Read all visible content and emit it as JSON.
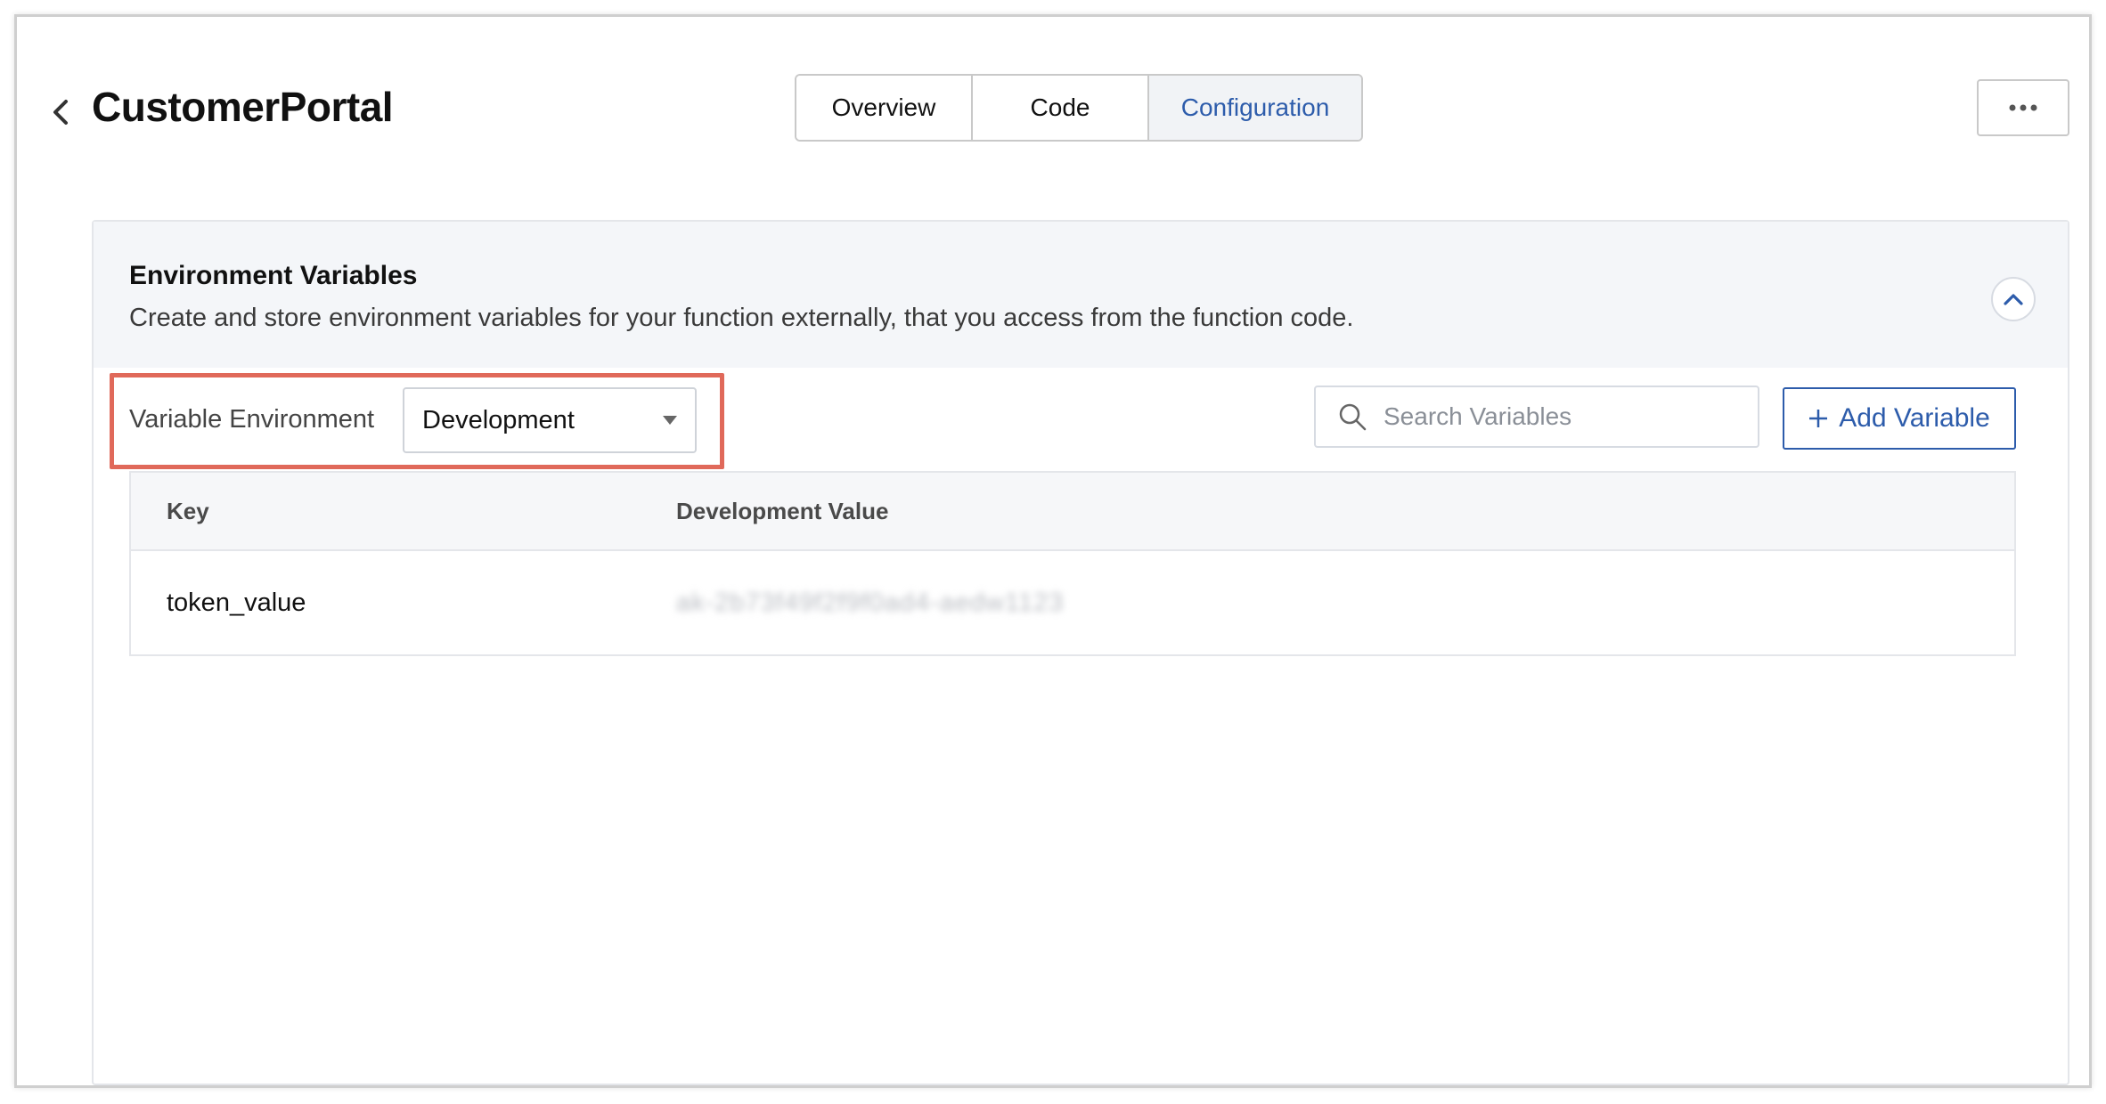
{
  "header": {
    "title": "CustomerPortal",
    "tabs": [
      {
        "label": "Overview",
        "active": false
      },
      {
        "label": "Code",
        "active": false
      },
      {
        "label": "Configuration",
        "active": true
      }
    ],
    "more_label": "•••"
  },
  "section": {
    "title": "Environment Variables",
    "description": "Create and store environment variables for your function externally, that you access from the function code."
  },
  "toolbar": {
    "env_label": "Variable Environment",
    "env_selected": "Development",
    "search_placeholder": "Search Variables",
    "add_label": "Add Variable"
  },
  "table": {
    "columns": [
      "Key",
      "Development Value"
    ],
    "rows": [
      {
        "key": "token_value",
        "value": "ak-2b73f49f2f9f0ad4-aedw1123"
      }
    ]
  },
  "colors": {
    "accent": "#2d5cab",
    "highlight": "#e0695a"
  }
}
